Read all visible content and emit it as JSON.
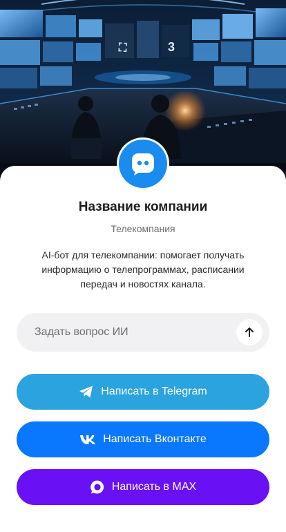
{
  "profile": {
    "company_name": "Название компании",
    "company_type": "Телекомпания",
    "description": "AI-бот для телекомпании: помогает получать информацию о телепрограммах, расписании передач и новостях канала."
  },
  "ask": {
    "placeholder": "Задать вопрос ИИ"
  },
  "actions": {
    "telegram_label": "Написать в Telegram",
    "vk_label": "Написать Вконтакте",
    "max_label": "Написать в MAX"
  },
  "hero_screen_digit": "3",
  "icons": {
    "avatar": "chat-bot-icon",
    "send": "arrow-up-icon",
    "telegram": "telegram-icon",
    "vk": "vk-icon",
    "max": "max-icon"
  },
  "colors": {
    "avatar": "#1a8cf0",
    "telegram": "#2aa3df",
    "vk": "#0a77ff",
    "max": "#6a10f5",
    "input_bg": "#f1f1f3"
  }
}
